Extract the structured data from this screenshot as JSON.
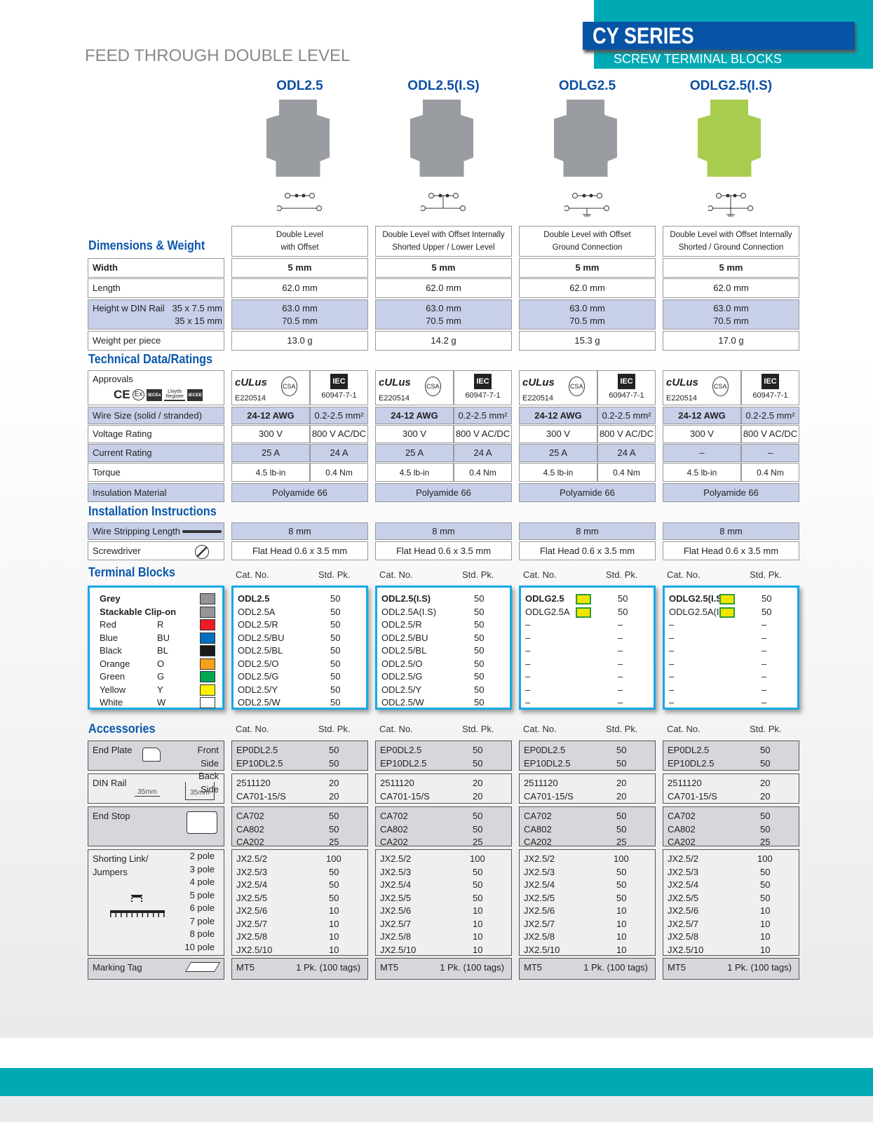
{
  "header": {
    "subtitle": "FEED THROUGH DOUBLE LEVEL",
    "series": "CY SERIES",
    "series_sub": "SCREW TERMINAL BLOCKS"
  },
  "colors": {
    "accent_blue": "#0b58ab",
    "teal": "#00aab5",
    "row_blue": "#c8cfe9"
  },
  "sections": {
    "dim": "Dimensions & Weight",
    "tech": "Technical Data/Ratings",
    "install": "Installation Instructions",
    "tb": "Terminal Blocks",
    "acc": "Accessories"
  },
  "labels": {
    "width": "Width",
    "length": "Length",
    "height": "Height w DIN Rail",
    "h1": "35 x 7.5 mm",
    "h2": "35 x 15 mm",
    "weight": "Weight per piece",
    "approvals": "Approvals",
    "wire": "Wire Size (solid / stranded)",
    "voltage": "Voltage Rating",
    "current": "Current Rating",
    "torque": "Torque",
    "insulation": "Insulation Material",
    "strip": "Wire Stripping Length",
    "screwdriver": "Screwdriver",
    "cat": "Cat. No.",
    "std": "Std. Pk."
  },
  "approval_marks": {
    "ul": "cULus",
    "file": "E220514",
    "csa": "CSA",
    "iec": "IEC",
    "iec_std": "60947-7-1",
    "left": [
      "CE",
      "Ex",
      "IECEx",
      "Lloyds Register",
      "IECEE"
    ]
  },
  "colors_list": [
    {
      "name": "Grey",
      "code": "",
      "swatch": "#939598",
      "bold": true
    },
    {
      "name": "Stackable Clip-on",
      "code": "",
      "swatch": "#939598",
      "bold": true
    },
    {
      "name": "Red",
      "code": "R",
      "swatch": "#ed1c24"
    },
    {
      "name": "Blue",
      "code": "BU",
      "swatch": "#0070c0"
    },
    {
      "name": "Black",
      "code": "BL",
      "swatch": "#1a1a1a"
    },
    {
      "name": "Orange",
      "code": "O",
      "swatch": "#f7a11a"
    },
    {
      "name": "Green",
      "code": "G",
      "swatch": "#00a651"
    },
    {
      "name": "Yellow",
      "code": "Y",
      "swatch": "#fff200"
    },
    {
      "name": "White",
      "code": "W",
      "swatch": "#ffffff"
    }
  ],
  "accessories": {
    "end_plate": {
      "label": "End Plate",
      "front": "Front Side",
      "back": "Back Side"
    },
    "din": {
      "label": "DIN Rail",
      "rail": "35mm"
    },
    "end_stop": {
      "label": "End Stop"
    },
    "shorting": {
      "label1": "Shorting Link/",
      "label2": "Jumpers",
      "poles": [
        "2 pole",
        "3 pole",
        "4 pole",
        "5 pole",
        "6 pole",
        "7 pole",
        "8 pole",
        "10 pole"
      ]
    },
    "marking": {
      "label": "Marking Tag"
    },
    "rows": {
      "end_plate": [
        [
          "EP0DL2.5",
          "50"
        ],
        [
          "EP10DL2.5",
          "50"
        ]
      ],
      "din": [
        [
          "2511120",
          "20"
        ],
        [
          "CA701-15/S",
          "20"
        ]
      ],
      "end_stop": [
        [
          "CA702",
          "50"
        ],
        [
          "CA802",
          "50"
        ],
        [
          "CA202",
          "25"
        ]
      ],
      "shorting": [
        [
          "JX2.5/2",
          "100"
        ],
        [
          "JX2.5/3",
          "50"
        ],
        [
          "JX2.5/4",
          "50"
        ],
        [
          "JX2.5/5",
          "50"
        ],
        [
          "JX2.5/6",
          "10"
        ],
        [
          "JX2.5/7",
          "10"
        ],
        [
          "JX2.5/8",
          "10"
        ],
        [
          "JX2.5/10",
          "10"
        ]
      ],
      "marking": [
        [
          "MT5",
          "1 Pk. (100 tags)"
        ]
      ]
    }
  },
  "products": [
    {
      "name": "ODL2.5",
      "body": "#8e9196",
      "desc": [
        "Double Level",
        "with Offset"
      ],
      "width": "5 mm",
      "length": "62.0 mm",
      "h1": "63.0 mm",
      "h2": "70.5 mm",
      "weight": "13.0 g",
      "awg": "24-12 AWG",
      "mm": "0.2-2.5 mm²",
      "v1": "300 V",
      "v2": "800 V AC/DC",
      "c1": "25 A",
      "c2": "24 A",
      "t1": "4.5 lb-in",
      "t2": "0.4 Nm",
      "ins": "Polyamide 66",
      "strip": "8 mm",
      "sd": "Flat Head 0.6 x 3.5 mm",
      "tb": [
        [
          "ODL2.5",
          "50"
        ],
        [
          "ODL2.5A",
          "50"
        ],
        [
          "ODL2.5/R",
          "50"
        ],
        [
          "ODL2.5/BU",
          "50"
        ],
        [
          "ODL2.5/BL",
          "50"
        ],
        [
          "ODL2.5/O",
          "50"
        ],
        [
          "ODL2.5/G",
          "50"
        ],
        [
          "ODL2.5/Y",
          "50"
        ],
        [
          "ODL2.5/W",
          "50"
        ]
      ]
    },
    {
      "name": "ODL2.5(I.S)",
      "body": "#8e9196",
      "desc": [
        "Double Level with Offset Internally",
        "Shorted Upper / Lower Level"
      ],
      "width": "5 mm",
      "length": "62.0 mm",
      "h1": "63.0 mm",
      "h2": "70.5 mm",
      "weight": "14.2 g",
      "awg": "24-12 AWG",
      "mm": "0.2-2.5 mm²",
      "v1": "300 V",
      "v2": "800 V AC/DC",
      "c1": "25 A",
      "c2": "24 A",
      "t1": "4.5 lb-in",
      "t2": "0.4 Nm",
      "ins": "Polyamide 66",
      "strip": "8 mm",
      "sd": "Flat Head 0.6 x 3.5 mm",
      "tb": [
        [
          "ODL2.5(I.S)",
          "50"
        ],
        [
          "ODL2.5A(I.S)",
          "50"
        ],
        [
          "ODL2.5/R",
          "50"
        ],
        [
          "ODL2.5/BU",
          "50"
        ],
        [
          "ODL2.5/BL",
          "50"
        ],
        [
          "ODL2.5/O",
          "50"
        ],
        [
          "ODL2.5/G",
          "50"
        ],
        [
          "ODL2.5/Y",
          "50"
        ],
        [
          "ODL2.5/W",
          "50"
        ]
      ]
    },
    {
      "name": "ODLG2.5",
      "body": "#8e9196",
      "desc": [
        "Double Level with Offset",
        "Ground Connection"
      ],
      "width": "5 mm",
      "length": "62.0 mm",
      "h1": "63.0 mm",
      "h2": "70.5 mm",
      "weight": "15.3 g",
      "awg": "24-12 AWG",
      "mm": "0.2-2.5 mm²",
      "v1": "300 V",
      "v2": "800 V AC/DC",
      "c1": "25 A",
      "c2": "24 A",
      "t1": "4.5 lb-in",
      "t2": "0.4 Nm",
      "ins": "Polyamide 66",
      "strip": "8 mm",
      "sd": "Flat Head 0.6 x 3.5 mm",
      "tb": [
        [
          "ODLG2.5",
          "50"
        ],
        [
          "ODLG2.5A",
          "50"
        ],
        [
          "–",
          "–"
        ],
        [
          "–",
          "–"
        ],
        [
          "–",
          "–"
        ],
        [
          "–",
          "–"
        ],
        [
          "–",
          "–"
        ],
        [
          "–",
          "–"
        ],
        [
          "–",
          "–"
        ]
      ]
    },
    {
      "name": "ODLG2.5(I.S)",
      "body": "#9fc63b",
      "desc": [
        "Double Level with Offset Internally",
        "Shorted / Ground Connection"
      ],
      "width": "5 mm",
      "length": "62.0 mm",
      "h1": "63.0 mm",
      "h2": "70.5 mm",
      "weight": "17.0 g",
      "awg": "24-12 AWG",
      "mm": "0.2-2.5 mm²",
      "v1": "300 V",
      "v2": "800 V AC/DC",
      "c1": "–",
      "c2": "–",
      "t1": "4.5 lb-in",
      "t2": "0.4 Nm",
      "ins": "Polyamide 66",
      "strip": "8 mm",
      "sd": "Flat Head 0.6 x 3.5 mm",
      "tb": [
        [
          "ODLG2.5(I.S)",
          "50"
        ],
        [
          "ODLG2.5A(I.S)",
          "50"
        ],
        [
          "–",
          "–"
        ],
        [
          "–",
          "–"
        ],
        [
          "–",
          "–"
        ],
        [
          "–",
          "–"
        ],
        [
          "–",
          "–"
        ],
        [
          "–",
          "–"
        ],
        [
          "–",
          "–"
        ]
      ]
    }
  ]
}
